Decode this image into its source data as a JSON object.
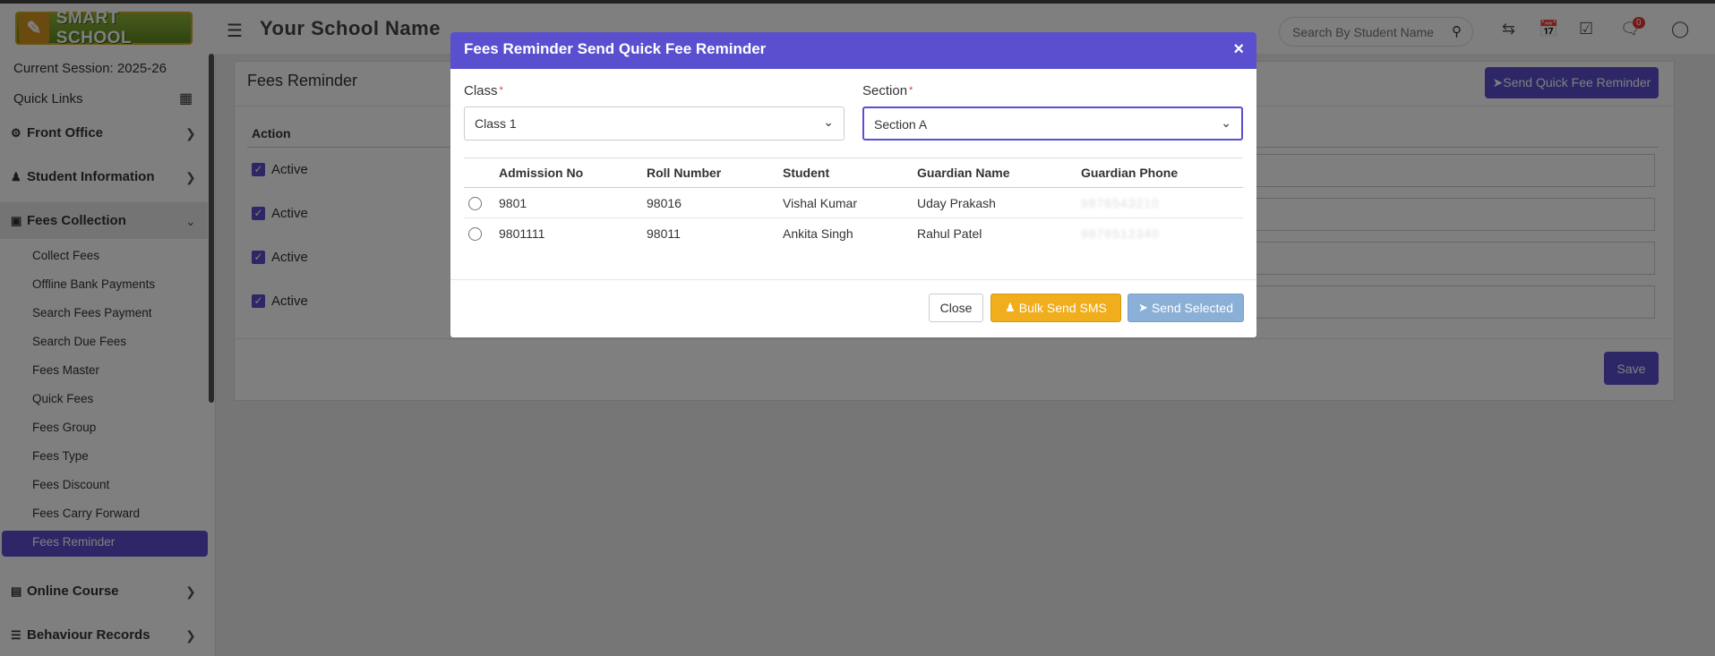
{
  "header": {
    "logo_text": "SMART SCHOOL",
    "school_name": "Your School Name",
    "search_placeholder": "Search By Student Name",
    "notification_count": "0"
  },
  "sidebar": {
    "session": "Current Session: 2025-26",
    "quick_links": "Quick Links",
    "sections": {
      "front_office": "Front Office",
      "student_information": "Student Information",
      "fees_collection": "Fees Collection",
      "online_course": "Online Course",
      "behaviour_records": "Behaviour Records"
    },
    "fees_items": [
      "Collect Fees",
      "Offline Bank Payments",
      "Search Fees Payment",
      "Search Due Fees",
      "Fees Master",
      "Quick Fees",
      "Fees Group",
      "Fees Type",
      "Fees Discount",
      "Fees Carry Forward",
      "Fees Reminder"
    ]
  },
  "main": {
    "title": "Fees Reminder",
    "send_quick_button": "Send Quick Fee Reminder",
    "action_header": "Action",
    "active_label": "Active",
    "save_label": "Save"
  },
  "modal": {
    "title": "Fees Reminder Send Quick Fee Reminder",
    "close_x": "×",
    "class_label": "Class",
    "class_value": "Class 1",
    "section_label": "Section",
    "section_value": "Section A",
    "columns": [
      "Admission No",
      "Roll Number",
      "Student",
      "Guardian Name",
      "Guardian Phone"
    ],
    "rows": [
      {
        "admission_no": "9801",
        "roll_number": "98016",
        "student": "Vishal Kumar",
        "guardian_name": "Uday Prakash",
        "guardian_phone": "9876543210"
      },
      {
        "admission_no": "9801111",
        "roll_number": "98011",
        "student": "Ankita Singh",
        "guardian_name": "Rahul Patel",
        "guardian_phone": "9876512340"
      }
    ],
    "close_button": "Close",
    "bulk_button": "Bulk Send SMS",
    "send_selected_button": "Send Selected"
  }
}
